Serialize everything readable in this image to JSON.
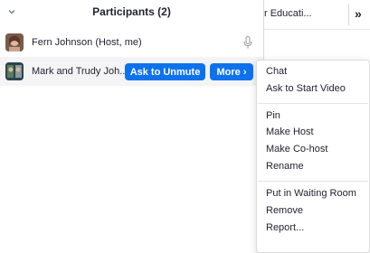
{
  "background_window": {
    "tab_label": "r Educati...",
    "more_chevron": "»"
  },
  "panel": {
    "title": "Participants (2)",
    "collapse_icon": "chevron-down-icon",
    "participants": [
      {
        "name": "Fern Johnson (Host, me)",
        "avatar": "avatar",
        "mic_icon": "microphone-muted-icon"
      },
      {
        "name": "Mark and Trudy Joh...",
        "avatar": "avatar",
        "unmute_label": "Ask to Unmute",
        "more_label": "More ›"
      }
    ]
  },
  "context_menu": {
    "group1": [
      "Chat",
      "Ask to Start Video"
    ],
    "group2": [
      "Pin",
      "Make Host",
      "Make Co-host",
      "Rename"
    ],
    "group3": [
      "Put in Waiting Room",
      "Remove",
      "Report..."
    ]
  },
  "colors": {
    "accent": "#0e72ed",
    "text": "#232333",
    "row_hover": "#f4f4f6"
  }
}
